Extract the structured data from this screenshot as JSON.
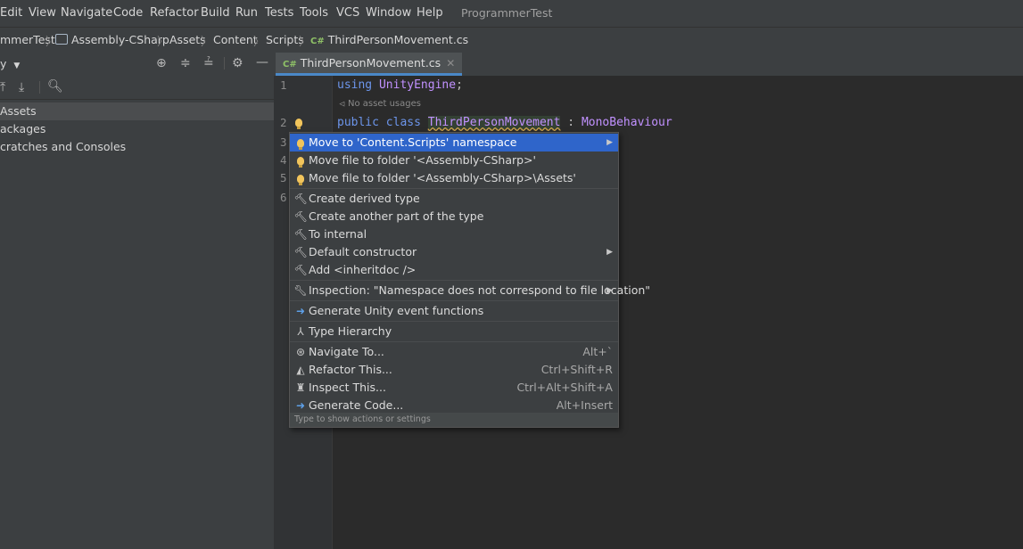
{
  "menubar": {
    "items": [
      "Edit",
      "View",
      "Navigate",
      "Code",
      "Refactor",
      "Build",
      "Run",
      "Tests",
      "Tools",
      "VCS",
      "Window",
      "Help"
    ],
    "project_title": "ProgrammerTest"
  },
  "breadcrumb": {
    "items": [
      "mmerTest",
      "Assembly-CSharp",
      "Assets",
      "Content",
      "Scripts",
      "ThirdPersonMovement.cs"
    ]
  },
  "project_panel": {
    "view_label": "y",
    "tree": [
      "Assets",
      "ackages",
      "cratches and Consoles"
    ],
    "selected_index": 0
  },
  "editor": {
    "tab_title": "ThirdPersonMovement.cs",
    "line_numbers": [
      "1",
      "2",
      "3",
      "4",
      "5",
      "6"
    ],
    "line1": {
      "kw": "using",
      "ns": "UnityEngine",
      "end": ";"
    },
    "hint": "No asset usages",
    "line2": {
      "kw": "public class",
      "cls": "ThirdPersonMovement",
      "colon": ":",
      "base": "MonoBehaviour"
    }
  },
  "popup": {
    "items": [
      {
        "label": "Move to 'Content.Scripts' namespace",
        "icon": "bulb-icon",
        "submenu": true,
        "selected": true
      },
      {
        "label": "Move file to folder '<Assembly-CSharp>'",
        "icon": "bulb-icon"
      },
      {
        "label": "Move file to folder '<Assembly-CSharp>\\Assets'",
        "icon": "bulb-icon"
      },
      {
        "label": "Create derived type",
        "icon": "hammer-icon"
      },
      {
        "label": "Create another part of the type",
        "icon": "hammer-icon"
      },
      {
        "label": "To internal",
        "icon": "hammer-icon"
      },
      {
        "label": "Default constructor",
        "icon": "hammer-icon",
        "submenu": true
      },
      {
        "label": "Add <inheritdoc />",
        "icon": "hammer-icon"
      },
      {
        "label": "Inspection: \"Namespace does not correspond to file location\"",
        "icon": "wrench-icon",
        "submenu": true
      },
      {
        "label": "Generate Unity event functions",
        "icon": "generate-icon"
      },
      {
        "label": "Type Hierarchy",
        "icon": "hierarchy-icon"
      },
      {
        "label": "Navigate To...",
        "icon": "navigate-icon",
        "shortcut": "Alt+`"
      },
      {
        "label": "Refactor This...",
        "icon": "refactor-icon",
        "shortcut": "Ctrl+Shift+R"
      },
      {
        "label": "Inspect This...",
        "icon": "inspect-icon",
        "shortcut": "Ctrl+Alt+Shift+A"
      },
      {
        "label": "Generate Code...",
        "icon": "generate-icon",
        "shortcut": "Alt+Insert"
      }
    ],
    "footer": "Type to show actions or settings"
  },
  "colors": {
    "selection": "#2f65ca",
    "keyword": "#6c95eb",
    "type": "#c191ff",
    "bulb": "#f2c55c"
  }
}
